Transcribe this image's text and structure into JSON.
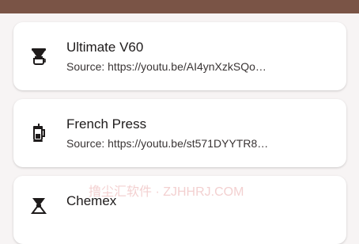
{
  "app_bar": {
    "color": "#7a5446"
  },
  "recipes": [
    {
      "title": "Ultimate V60",
      "subtitle": "Source: https://youtu.be/AI4ynXzkSQo…",
      "icon": "pour-over-dripper-icon"
    },
    {
      "title": "French Press",
      "subtitle": "Source: https://youtu.be/st571DYYTR8…",
      "icon": "french-press-icon"
    },
    {
      "title": "Chemex",
      "subtitle": "",
      "icon": "chemex-icon"
    }
  ],
  "watermark": "撸尘汇软件 · ZJHHRJ.COM"
}
